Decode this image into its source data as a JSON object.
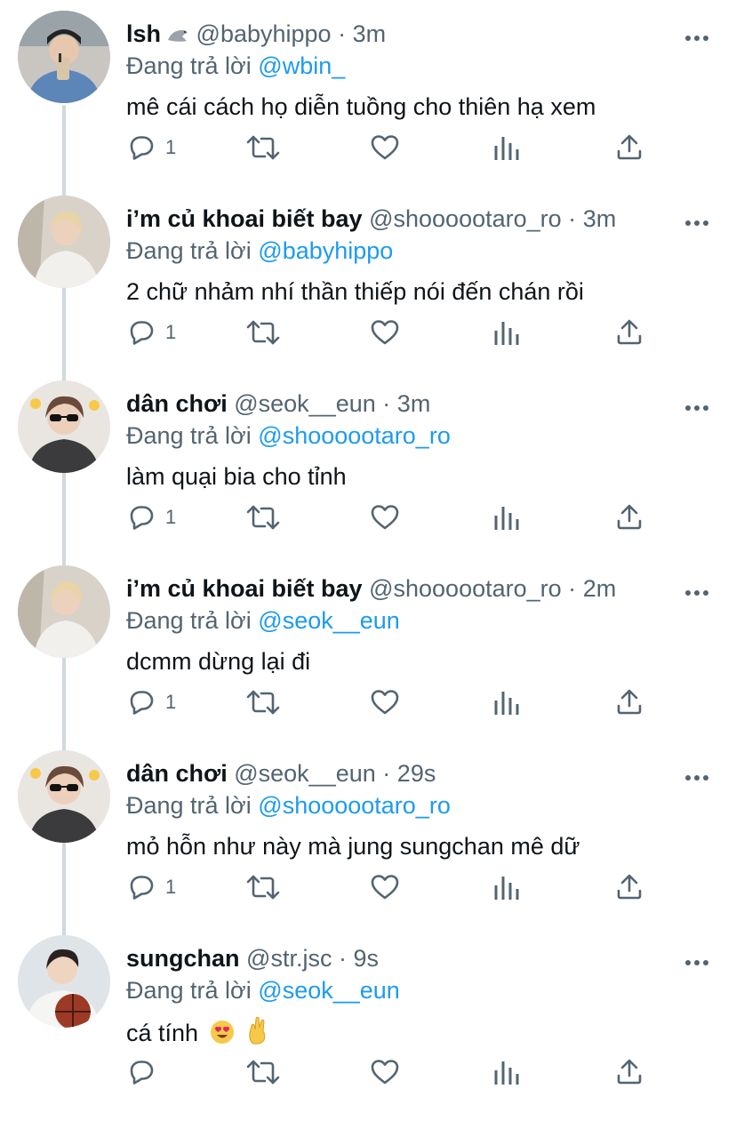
{
  "colors": {
    "link_blue": "#1d9bf0",
    "secondary_gray": "#536471",
    "text_dark": "#0f1419",
    "thread_line": "#cfd9de"
  },
  "reply_prefix": "Đang trả lời",
  "tweets": [
    {
      "display_name": "lsh",
      "badge": "seal-emoji",
      "handle": "@babyhippo",
      "dot": "·",
      "time": "3m",
      "reply_to": "@wbin_",
      "text": "mê cái cách họ diễn tuồng cho thiên hạ xem",
      "reply_count": "1",
      "avatar": "man-denim-jacket-drink"
    },
    {
      "display_name": "i’m củ khoai biết bay",
      "handle": "@shoooootaro_ro",
      "dot": "·",
      "time": "3m",
      "reply_to": "@babyhippo",
      "text": "2 chữ nhảm nhí thần thiếp nói đến chán rồi",
      "reply_count": "1",
      "avatar": "blond-man-white-shirt"
    },
    {
      "display_name": "dân chơi",
      "handle": "@seok__eun",
      "dot": "·",
      "time": "3m",
      "reply_to": "@shoooootaro_ro",
      "text": "làm quại bia cho tỉnh",
      "reply_count": "1",
      "avatar": "man-sunglasses-dark-tee"
    },
    {
      "display_name": "i’m củ khoai biết bay",
      "handle": "@shoooootaro_ro",
      "dot": "·",
      "time": "2m",
      "reply_to": "@seok__eun",
      "text": "dcmm dừng lại đi",
      "reply_count": "1",
      "avatar": "blond-man-white-shirt"
    },
    {
      "display_name": "dân chơi",
      "handle": "@seok__eun",
      "dot": "·",
      "time": "29s",
      "reply_to": "@shoooootaro_ro",
      "text": "mỏ hỗn như này mà jung sungchan mê dữ",
      "reply_count": "1",
      "avatar": "man-sunglasses-dark-tee"
    },
    {
      "display_name": "sungchan",
      "handle": "@str.jsc",
      "dot": "·",
      "time": "9s",
      "reply_to": "@seok__eun",
      "text": "cá tính",
      "emojis": [
        "heart-eyes-emoji",
        "crossed-fingers-emoji"
      ],
      "reply_count": "",
      "avatar": "man-with-basketball"
    }
  ],
  "action_icons": [
    "reply-icon",
    "retweet-icon",
    "like-icon",
    "analytics-icon",
    "share-icon"
  ],
  "menu_icon": "more-options-icon"
}
